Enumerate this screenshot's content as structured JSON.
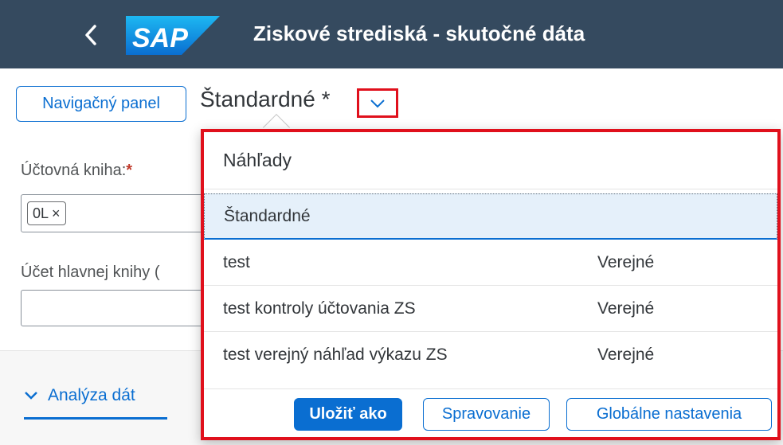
{
  "shell": {
    "title": "Ziskové strediská - skutočné dáta",
    "logo_text": "SAP",
    "back_icon": "chevron-left-icon",
    "background": "#354a5f",
    "logo_color": "#0a9edb"
  },
  "variant_bar": {
    "nav_button": "Navigačný panel",
    "current_variant": "Štandardné *",
    "toggle_icon": "chevron-down-icon"
  },
  "filters": {
    "ledger_label": "Účtovná kniha:",
    "ledger_required": "*",
    "ledger_token": "0L",
    "token_remove": "×",
    "gl_account_label": "Účet hlavnej knihy ("
  },
  "tabs": {
    "analysis_label": "Analýza dát"
  },
  "popover": {
    "title": "Náhľady",
    "variants": [
      {
        "name": "Štandardné",
        "visibility": ""
      },
      {
        "name": "test",
        "visibility": "Verejné"
      },
      {
        "name": "test kontroly účtovania ZS",
        "visibility": "Verejné"
      },
      {
        "name": "test verejný náhľad výkazu ZS",
        "visibility": "Verejné"
      }
    ],
    "buttons": {
      "save_as": "Uložiť ako",
      "manage": "Spravovanie",
      "global_settings": "Globálne nastavenia"
    }
  },
  "colors": {
    "accent": "#0a6ed1",
    "highlight": "#e0101c"
  }
}
